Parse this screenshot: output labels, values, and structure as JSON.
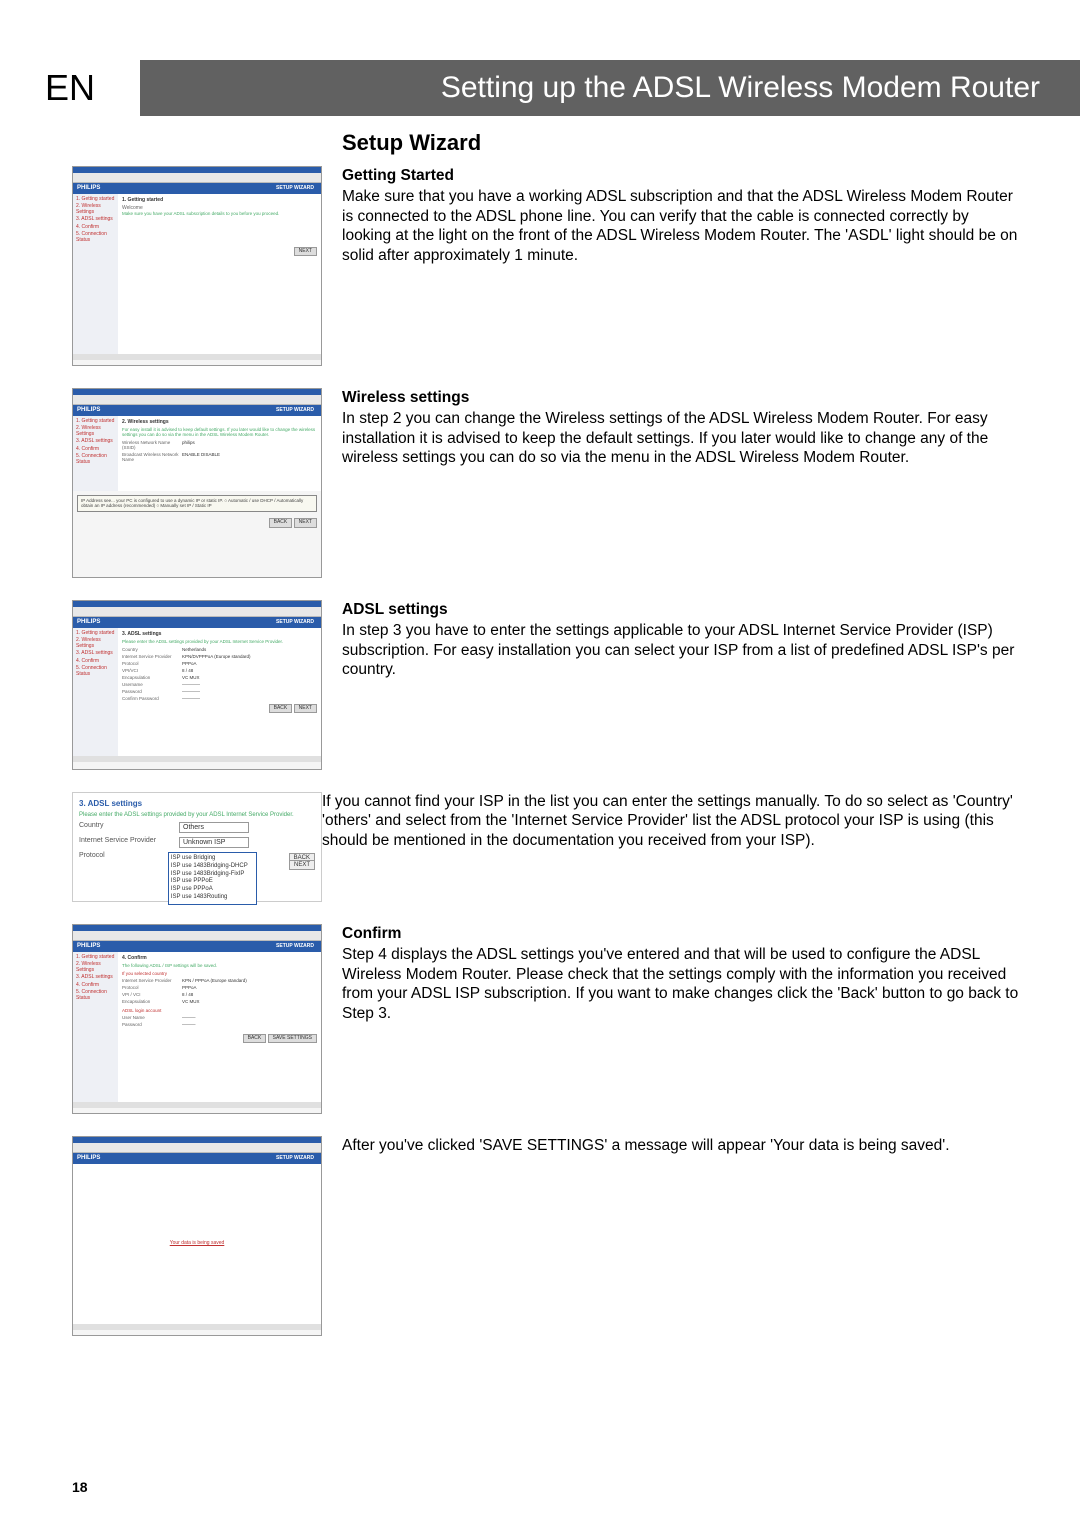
{
  "header": {
    "lang": "EN",
    "title": "Setting up the ADSL Wireless Modem Router"
  },
  "page_number": "18",
  "section_title": "Setup Wizard",
  "sections": [
    {
      "heading": "Getting Started",
      "body": "Make sure that you have a working ADSL subscription and that the ADSL Wireless Modem Router is connected to the ADSL phone line. You can verify that the cable is connected correctly by looking at the light on the front of the ADSL Wireless Modem Router. The 'ASDL' light should be on solid after approximately 1 minute."
    },
    {
      "heading": "Wireless settings",
      "body": "In step 2 you can change the Wireless settings of the ADSL Wireless Modem Router. For easy installation it is advised to keep the default settings. If you later would like to change any of the wireless settings you can do so via the menu in the ADSL Wireless Modem Router."
    },
    {
      "heading": "ADSL settings",
      "body": "In step 3 you have to enter the settings applicable to your ADSL Internet Service Provider (ISP) subscription. For easy installation you can select your ISP from a list of predefined ADSL ISP's per country."
    },
    {
      "heading": "",
      "body": "If you cannot find your ISP in the list you can enter the settings manually. To do so select as 'Country' 'others' and select from the 'Internet Service Provider' list the ADSL protocol your ISP is using (this should be mentioned in the documentation you received from your ISP)."
    },
    {
      "heading": "Confirm",
      "body": "Step 4 displays the ADSL settings you've entered and that will be used to configure the ADSL Wireless Modem Router. Please check that the settings comply with the information you received from your ADSL ISP subscription. If you want to make changes click the 'Back' button to go back to Step 3."
    },
    {
      "heading": "",
      "body": "After you've clicked 'SAVE SETTINGS' a message will appear 'Your data is being saved'."
    }
  ],
  "screenshots": {
    "brand": "PHILIPS",
    "tab": "SETUP WIZARD",
    "s1": {
      "title": "1. Getting started",
      "desc": "Welcome",
      "note": "Make sure you have your ADSL subscription details to you before you proceed.",
      "next": "NEXT",
      "side": [
        "1. Getting started",
        "2. Wireless Settings",
        "3. ADSL settings",
        "4. Confirm",
        "5. Connection Status"
      ]
    },
    "s2": {
      "title": "2. Wireless settings",
      "desc": "For easy install it is advised to keep default settings. If you later would like to change the wireless settings you can do so via the menu in the ADSL Wireless Modem Router.",
      "fields": [
        {
          "lbl": "Wireless Network Name (SSID)",
          "val": "philips"
        },
        {
          "lbl": "Broadcast Wireless Network Name",
          "val": "ENABLE  DISABLE"
        }
      ],
      "popup": "IP Address see...   your PC is configured to use a dynamic IP or static IP.\n  ○ Automatic / use DHCP / Automatically obtain an IP address (recommended)\n  ○ Manually set IP / Static IP",
      "btns": [
        "BACK",
        "NEXT"
      ]
    },
    "s3": {
      "title": "3. ADSL settings",
      "desc": "Please enter the ADSL settings provided by your ADSL Internet Service Provider.",
      "fields": [
        {
          "lbl": "Country",
          "val": "Netherlands"
        },
        {
          "lbl": "Internet Service Provider",
          "val": "KPN/DVPPPoA (Europe standard)"
        },
        {
          "lbl": "Protocol",
          "val": "PPPoA"
        },
        {
          "lbl": "VPI/VCI",
          "val": "8 / 48"
        },
        {
          "lbl": "Encapsulation",
          "val": "VC MUX"
        },
        {
          "lbl": "Username",
          "val": "————"
        },
        {
          "lbl": "Password",
          "val": "————"
        },
        {
          "lbl": "Confirm Password",
          "val": "————"
        }
      ],
      "btns": [
        "BACK",
        "NEXT"
      ]
    },
    "s3b": {
      "title": "3. ADSL settings",
      "desc": "Please enter the ADSL settings provided by your ADSL Internet Service Provider.",
      "country_lbl": "Country",
      "country_val": "Others",
      "isp_lbl": "Internet Service Provider",
      "isp_val": "Unknown ISP",
      "protocol_lbl": "Protocol",
      "protocol_list": [
        "ISP use Bridging",
        "ISP use 1483Bridging-DHCP",
        "ISP use 1483Bridging-FixIP",
        "ISP use PPPoE",
        "ISP use PPPoA",
        "ISP use 1483Routing"
      ],
      "btns": [
        "BACK",
        "NEXT"
      ]
    },
    "s4": {
      "title": "4. Confirm",
      "desc": "The following ADSL / ISP settings will be saved.",
      "sub1": "If you selected country",
      "fields": [
        {
          "lbl": "Internet Service Provider",
          "val": "KPN / PPPoA (Europe standard)"
        },
        {
          "lbl": "Protocol",
          "val": "PPPoA"
        },
        {
          "lbl": "VPI / VCI",
          "val": "8 / 48"
        },
        {
          "lbl": "Encapsulation",
          "val": "VC MUX"
        }
      ],
      "sub2": "ADSL login account",
      "fields2": [
        {
          "lbl": "User Name",
          "val": "———"
        },
        {
          "lbl": "Password",
          "val": "———"
        }
      ],
      "btns": [
        "BACK",
        "SAVE SETTINGS"
      ]
    },
    "s5": {
      "msg": "Your data is being saved"
    }
  }
}
